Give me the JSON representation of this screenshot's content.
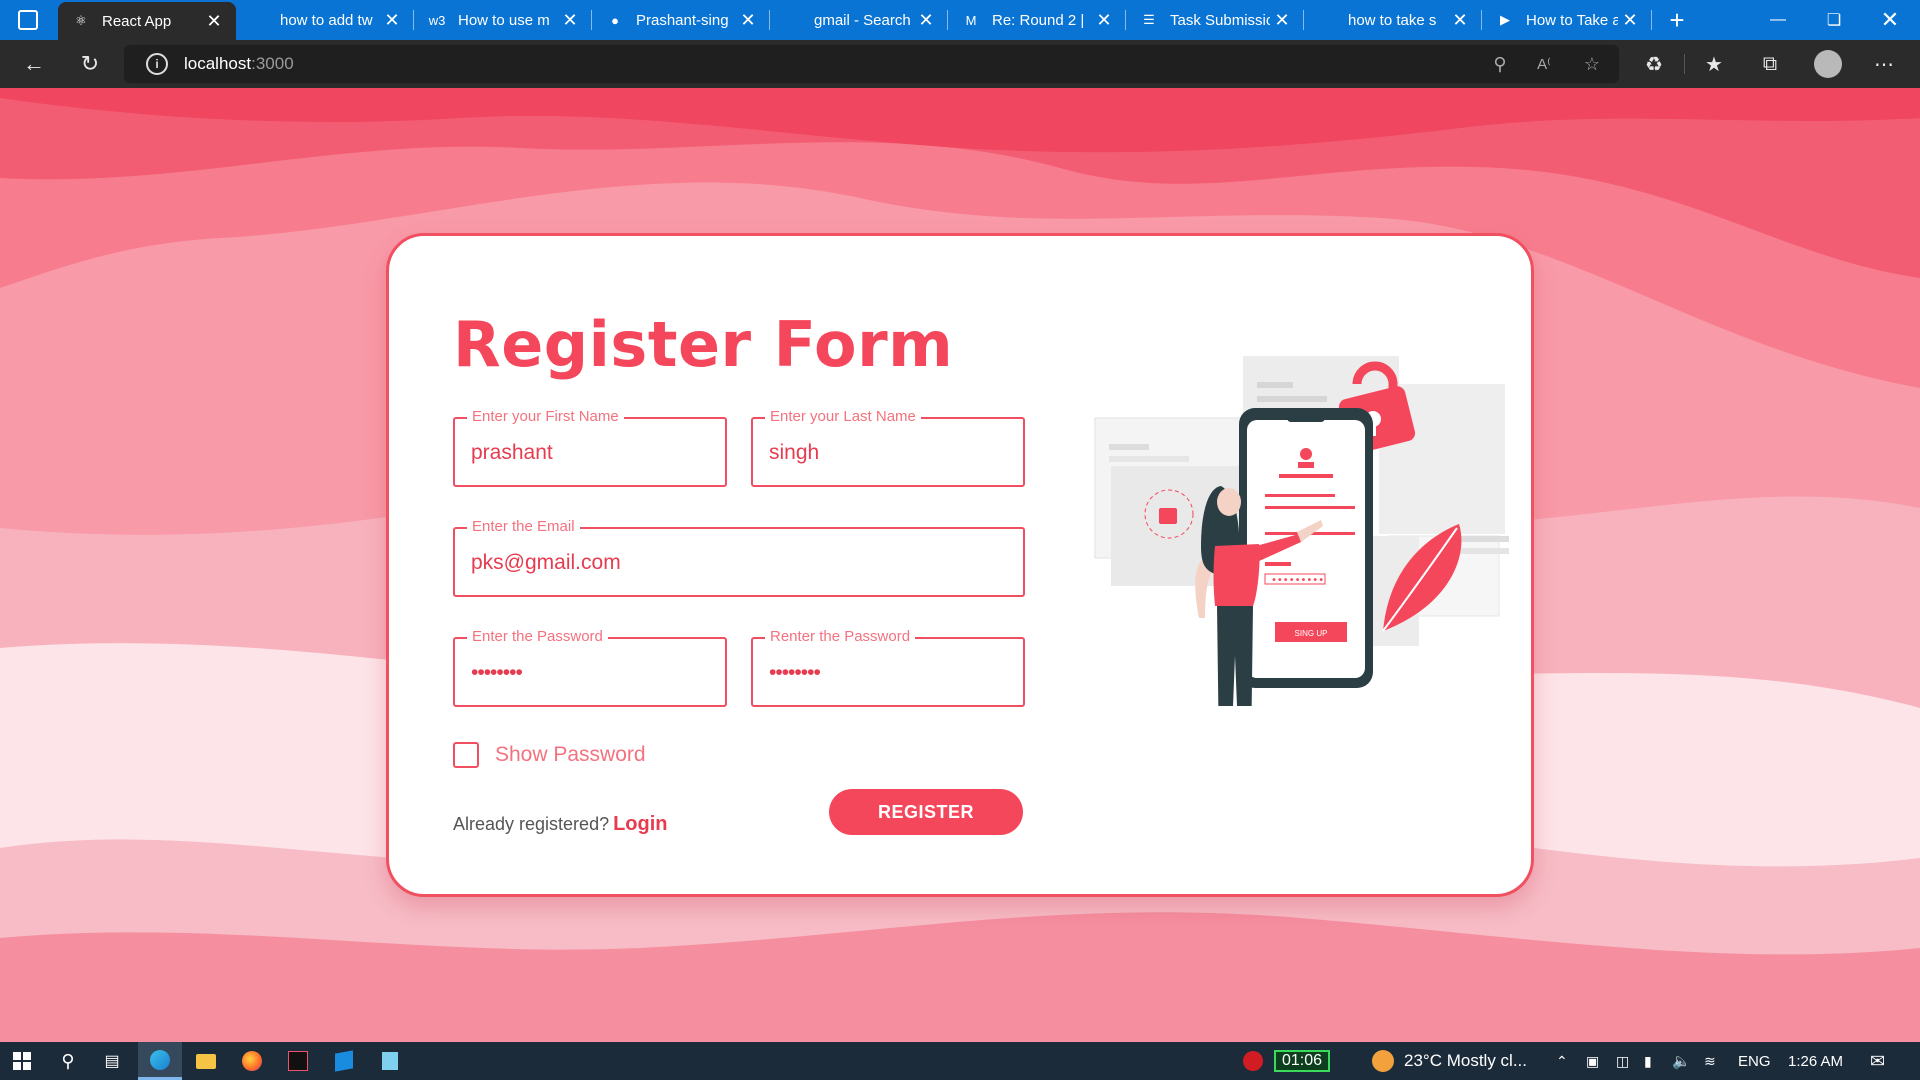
{
  "browser": {
    "tabs": [
      {
        "title": "React App",
        "icon": "react-icon",
        "active": true
      },
      {
        "title": "how to add tw",
        "icon": "blank-icon",
        "active": false
      },
      {
        "title": "How to use m",
        "icon": "w3schools-icon",
        "active": false
      },
      {
        "title": "Prashant-sing",
        "icon": "github-icon",
        "active": false
      },
      {
        "title": "gmail - Search",
        "icon": "blank-icon",
        "active": false
      },
      {
        "title": "Re: Round 2 |",
        "icon": "gmail-icon",
        "active": false
      },
      {
        "title": "Task Submissio",
        "icon": "forms-icon",
        "active": false
      },
      {
        "title": "how to take s",
        "icon": "blank-icon",
        "active": false
      },
      {
        "title": "How to Take a",
        "icon": "hub-icon",
        "active": false
      }
    ],
    "url_host": "localhost",
    "url_port": ":3000"
  },
  "form": {
    "title": "Register Form",
    "first_name": {
      "label": "Enter your First Name",
      "value": "prashant"
    },
    "last_name": {
      "label": "Enter your Last Name",
      "value": "singh"
    },
    "email": {
      "label": "Enter the Email",
      "value": "pks@gmail.com"
    },
    "password": {
      "label": "Enter the Password",
      "value": "••••••••"
    },
    "confirm_password": {
      "label": "Renter the Password",
      "value": "••••••••"
    },
    "show_password_label": "Show Password",
    "already_text": "Already registered?",
    "login_link": "Login",
    "register_button": "REGISTER",
    "illustration_button": "SING UP"
  },
  "colors": {
    "accent": "#f5475b",
    "border": "#f04e61",
    "label": "#f4727f"
  },
  "taskbar": {
    "timer": "01:06",
    "weather": "23°C  Mostly cl...",
    "language": "ENG",
    "time": "1:26 AM"
  }
}
